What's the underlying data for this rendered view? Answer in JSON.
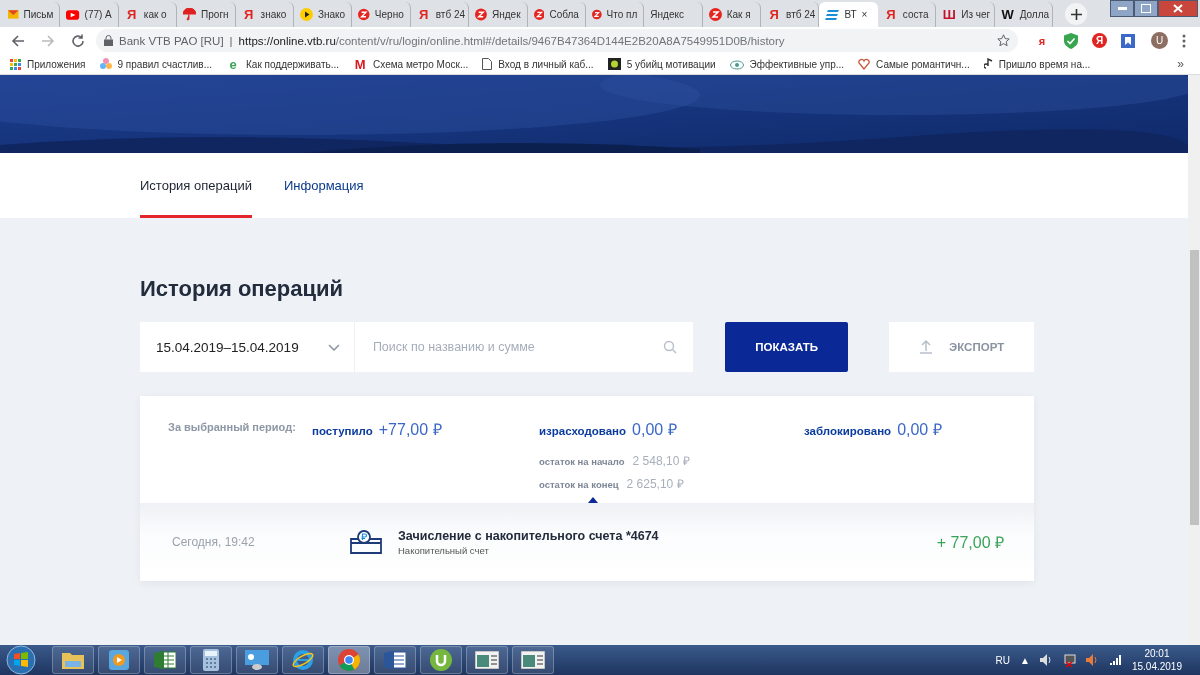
{
  "browser": {
    "tabs": [
      {
        "kind": "mail",
        "title": "Письм",
        "selected": false
      },
      {
        "kind": "youtube",
        "title": "(77) А",
        "selected": false
      },
      {
        "kind": "glyph",
        "glyph": "Я",
        "title": "как о",
        "selected": false
      },
      {
        "kind": "umbrella",
        "title": "Прогн",
        "selected": false
      },
      {
        "kind": "glyph",
        "glyph": "Я",
        "title": "знако",
        "selected": false
      },
      {
        "kind": "play",
        "title": "Знако",
        "selected": false
      },
      {
        "kind": "zen",
        "title": "Черно",
        "selected": false
      },
      {
        "kind": "glyph",
        "glyph": "Я",
        "title": "втб 24",
        "selected": false
      },
      {
        "kind": "zen",
        "title": "Яндек",
        "selected": false
      },
      {
        "kind": "zen",
        "title": "Собла",
        "selected": false
      },
      {
        "kind": "zen",
        "title": "Что пл",
        "selected": false
      },
      {
        "kind": "none",
        "title": "Яндекс",
        "selected": false
      },
      {
        "kind": "zen",
        "title": "Как я",
        "selected": false
      },
      {
        "kind": "glyph",
        "glyph": "Я",
        "title": "втб 24",
        "selected": false
      },
      {
        "kind": "vtb",
        "title": "ВТ",
        "selected": true,
        "close": "×"
      },
      {
        "kind": "glyph",
        "glyph": "Я",
        "title": "соста",
        "selected": false
      },
      {
        "kind": "glyph2",
        "glyph": "Ш",
        "title": "Из чег",
        "selected": false
      },
      {
        "kind": "wiki",
        "glyph": "W",
        "title": "Долла",
        "selected": false
      }
    ],
    "address": {
      "site": "Bank VTB PAO [RU]",
      "separator": "|",
      "host": "https://online.vtb.ru",
      "path": "/content/v/ru/login/online.html#/details/9467B47364D144E2B20A8A7549951D0B/history"
    },
    "extensions": [
      {
        "kind": "text",
        "glyph": "я"
      },
      {
        "kind": "shield"
      },
      {
        "kind": "circle",
        "glyph": "Я"
      },
      {
        "kind": "bookmark"
      }
    ],
    "profile": "U",
    "bookmarks": [
      {
        "kind": "apps",
        "title": "Приложения"
      },
      {
        "kind": "flower",
        "title": "9 правил счастлив..."
      },
      {
        "kind": "e",
        "glyph": "e",
        "title": "Как поддерживать..."
      },
      {
        "kind": "metro",
        "glyph": "М",
        "title": "Схема метро Моск..."
      },
      {
        "kind": "doc",
        "title": "Вход в личный каб..."
      },
      {
        "title": "5 убийц мотивации"
      },
      {
        "kind": "eye",
        "title": "Эффективные упр..."
      },
      {
        "kind": "heart",
        "title": "Самые романтичн..."
      },
      {
        "kind": "note",
        "title": "Пришло время на..."
      }
    ],
    "more": "»"
  },
  "page": {
    "tabs": [
      {
        "label": "История операций",
        "selected": true
      },
      {
        "label": "Информация",
        "selected": false
      }
    ],
    "heading": "История операций",
    "date_range": "15.04.2019–15.04.2019",
    "search": {
      "placeholder": "Поиск по названию и сумме"
    },
    "show_button": "ПОКАЗАТЬ",
    "export_button": "ЭКСПОРТ",
    "summary": {
      "label": "За выбранный период:",
      "totals": [
        {
          "label": "поступило",
          "amount": "+77,00 ₽"
        },
        {
          "label": "израсходовано",
          "amount": "0,00 ₽"
        },
        {
          "label": "заблокировано",
          "amount": "0,00 ₽"
        }
      ],
      "balances": [
        {
          "label": "остаток на начало",
          "amount": "2 548,10 ₽"
        },
        {
          "label": "остаток на конец",
          "amount": "2 625,10 ₽"
        }
      ]
    },
    "operations": [
      {
        "time": "Сегодня, 19:42",
        "title": "Зачисление с накопительного счета *4674",
        "subtitle": "Накопительный счет",
        "amount": "+ 77,00 ₽"
      }
    ]
  },
  "taskbar": {
    "apps": [
      {
        "kind": "folder",
        "active": false
      },
      {
        "kind": "media",
        "active": false
      },
      {
        "kind": "excel",
        "active": false
      },
      {
        "kind": "calc",
        "active": false
      },
      {
        "kind": "panel",
        "active": false
      },
      {
        "kind": "ie",
        "active": false
      },
      {
        "kind": "chrome",
        "active": true
      },
      {
        "kind": "word",
        "active": false
      },
      {
        "kind": "torrent",
        "active": false
      },
      {
        "kind": "window",
        "active": false
      },
      {
        "kind": "window",
        "active": false
      }
    ],
    "language": "RU",
    "tray_arrow": "▲",
    "time": "20:01",
    "date": "15.04.2019"
  }
}
